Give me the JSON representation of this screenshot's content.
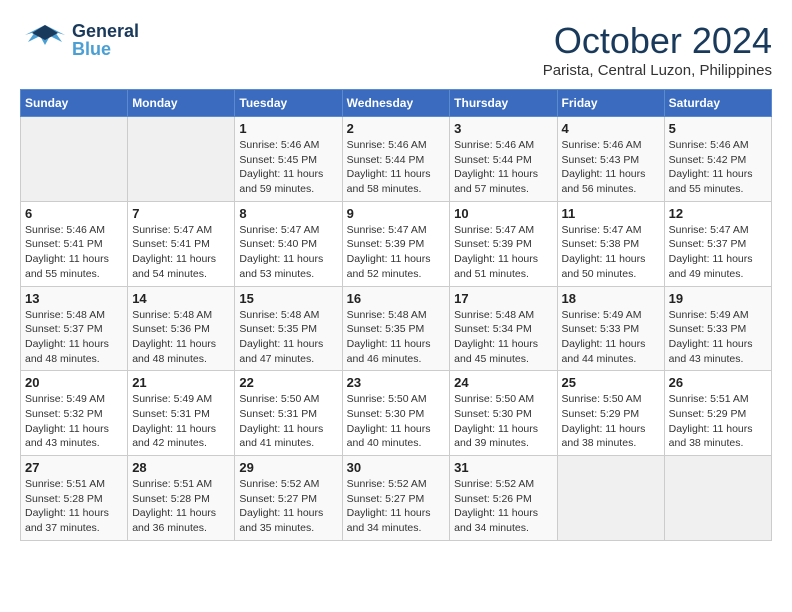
{
  "header": {
    "logo_general": "General",
    "logo_blue": "Blue",
    "month": "October 2024",
    "location": "Parista, Central Luzon, Philippines"
  },
  "weekdays": [
    "Sunday",
    "Monday",
    "Tuesday",
    "Wednesday",
    "Thursday",
    "Friday",
    "Saturday"
  ],
  "weeks": [
    [
      {
        "day": "",
        "detail": ""
      },
      {
        "day": "",
        "detail": ""
      },
      {
        "day": "1",
        "detail": "Sunrise: 5:46 AM\nSunset: 5:45 PM\nDaylight: 11 hours and 59 minutes."
      },
      {
        "day": "2",
        "detail": "Sunrise: 5:46 AM\nSunset: 5:44 PM\nDaylight: 11 hours and 58 minutes."
      },
      {
        "day": "3",
        "detail": "Sunrise: 5:46 AM\nSunset: 5:44 PM\nDaylight: 11 hours and 57 minutes."
      },
      {
        "day": "4",
        "detail": "Sunrise: 5:46 AM\nSunset: 5:43 PM\nDaylight: 11 hours and 56 minutes."
      },
      {
        "day": "5",
        "detail": "Sunrise: 5:46 AM\nSunset: 5:42 PM\nDaylight: 11 hours and 55 minutes."
      }
    ],
    [
      {
        "day": "6",
        "detail": "Sunrise: 5:46 AM\nSunset: 5:41 PM\nDaylight: 11 hours and 55 minutes."
      },
      {
        "day": "7",
        "detail": "Sunrise: 5:47 AM\nSunset: 5:41 PM\nDaylight: 11 hours and 54 minutes."
      },
      {
        "day": "8",
        "detail": "Sunrise: 5:47 AM\nSunset: 5:40 PM\nDaylight: 11 hours and 53 minutes."
      },
      {
        "day": "9",
        "detail": "Sunrise: 5:47 AM\nSunset: 5:39 PM\nDaylight: 11 hours and 52 minutes."
      },
      {
        "day": "10",
        "detail": "Sunrise: 5:47 AM\nSunset: 5:39 PM\nDaylight: 11 hours and 51 minutes."
      },
      {
        "day": "11",
        "detail": "Sunrise: 5:47 AM\nSunset: 5:38 PM\nDaylight: 11 hours and 50 minutes."
      },
      {
        "day": "12",
        "detail": "Sunrise: 5:47 AM\nSunset: 5:37 PM\nDaylight: 11 hours and 49 minutes."
      }
    ],
    [
      {
        "day": "13",
        "detail": "Sunrise: 5:48 AM\nSunset: 5:37 PM\nDaylight: 11 hours and 48 minutes."
      },
      {
        "day": "14",
        "detail": "Sunrise: 5:48 AM\nSunset: 5:36 PM\nDaylight: 11 hours and 48 minutes."
      },
      {
        "day": "15",
        "detail": "Sunrise: 5:48 AM\nSunset: 5:35 PM\nDaylight: 11 hours and 47 minutes."
      },
      {
        "day": "16",
        "detail": "Sunrise: 5:48 AM\nSunset: 5:35 PM\nDaylight: 11 hours and 46 minutes."
      },
      {
        "day": "17",
        "detail": "Sunrise: 5:48 AM\nSunset: 5:34 PM\nDaylight: 11 hours and 45 minutes."
      },
      {
        "day": "18",
        "detail": "Sunrise: 5:49 AM\nSunset: 5:33 PM\nDaylight: 11 hours and 44 minutes."
      },
      {
        "day": "19",
        "detail": "Sunrise: 5:49 AM\nSunset: 5:33 PM\nDaylight: 11 hours and 43 minutes."
      }
    ],
    [
      {
        "day": "20",
        "detail": "Sunrise: 5:49 AM\nSunset: 5:32 PM\nDaylight: 11 hours and 43 minutes."
      },
      {
        "day": "21",
        "detail": "Sunrise: 5:49 AM\nSunset: 5:31 PM\nDaylight: 11 hours and 42 minutes."
      },
      {
        "day": "22",
        "detail": "Sunrise: 5:50 AM\nSunset: 5:31 PM\nDaylight: 11 hours and 41 minutes."
      },
      {
        "day": "23",
        "detail": "Sunrise: 5:50 AM\nSunset: 5:30 PM\nDaylight: 11 hours and 40 minutes."
      },
      {
        "day": "24",
        "detail": "Sunrise: 5:50 AM\nSunset: 5:30 PM\nDaylight: 11 hours and 39 minutes."
      },
      {
        "day": "25",
        "detail": "Sunrise: 5:50 AM\nSunset: 5:29 PM\nDaylight: 11 hours and 38 minutes."
      },
      {
        "day": "26",
        "detail": "Sunrise: 5:51 AM\nSunset: 5:29 PM\nDaylight: 11 hours and 38 minutes."
      }
    ],
    [
      {
        "day": "27",
        "detail": "Sunrise: 5:51 AM\nSunset: 5:28 PM\nDaylight: 11 hours and 37 minutes."
      },
      {
        "day": "28",
        "detail": "Sunrise: 5:51 AM\nSunset: 5:28 PM\nDaylight: 11 hours and 36 minutes."
      },
      {
        "day": "29",
        "detail": "Sunrise: 5:52 AM\nSunset: 5:27 PM\nDaylight: 11 hours and 35 minutes."
      },
      {
        "day": "30",
        "detail": "Sunrise: 5:52 AM\nSunset: 5:27 PM\nDaylight: 11 hours and 34 minutes."
      },
      {
        "day": "31",
        "detail": "Sunrise: 5:52 AM\nSunset: 5:26 PM\nDaylight: 11 hours and 34 minutes."
      },
      {
        "day": "",
        "detail": ""
      },
      {
        "day": "",
        "detail": ""
      }
    ]
  ]
}
